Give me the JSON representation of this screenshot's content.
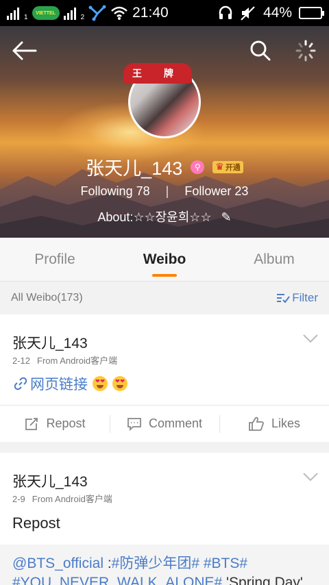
{
  "status_bar": {
    "sim1": "1",
    "carrier": "VIETTEL",
    "sim2": "2",
    "time": "21:40",
    "battery_percent": "44%",
    "battery_level": 0.44
  },
  "header": {
    "avatar_banner": "王 牌",
    "username": "张天儿_143",
    "vip_label": "开通",
    "following_label": "Following",
    "following_count": "78",
    "follower_label": "Follower",
    "follower_count": "23",
    "about": "About:☆☆장윤희☆☆"
  },
  "tabs": [
    {
      "label": "Profile"
    },
    {
      "label": "Weibo"
    },
    {
      "label": "Album"
    }
  ],
  "filter_bar": {
    "count_label": "All Weibo(173)",
    "filter_label": "Filter"
  },
  "posts": [
    {
      "user": "张天儿_143",
      "date": "2-12",
      "source": "From Android客户端",
      "link_text": "网页链接",
      "actions": {
        "repost": "Repost",
        "comment": "Comment",
        "likes": "Likes"
      }
    },
    {
      "user": "张天儿_143",
      "date": "2-9",
      "source": "From Android客户端",
      "body": "Repost",
      "quote": {
        "mention": "@BTS_official",
        "colon": " :",
        "tag1": "#防弹少年团#",
        "tag2": "#BTS#",
        "tag3": "#YOU_NEVER_WALK_ALONE#",
        "tail": " 'Spring Day'"
      }
    }
  ],
  "colors": {
    "accent": "#ff8200",
    "link": "#4a7cc7",
    "vip_gold": "#f3c34a",
    "banner_red": "#c8242a"
  }
}
